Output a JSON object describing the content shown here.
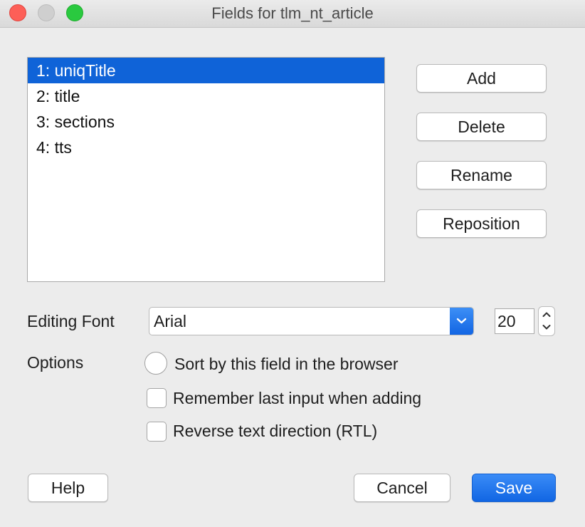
{
  "window": {
    "title": "Fields for tlm_nt_article"
  },
  "fields": {
    "items": [
      {
        "label": "1: uniqTitle"
      },
      {
        "label": "2: title"
      },
      {
        "label": "3: sections"
      },
      {
        "label": "4: tts"
      }
    ],
    "selected_index": 0
  },
  "actions": {
    "add": "Add",
    "delete": "Delete",
    "rename": "Rename",
    "reposition": "Reposition"
  },
  "editing_font": {
    "label": "Editing Font",
    "font": "Arial",
    "size": "20"
  },
  "options": {
    "label": "Options",
    "sort_by_field": {
      "label": "Sort by this field in the browser",
      "checked": false
    },
    "remember_last_input": {
      "label": "Remember last input when adding",
      "checked": false
    },
    "reverse_text_direction": {
      "label": "Reverse text direction (RTL)",
      "checked": false
    }
  },
  "footer": {
    "help": "Help",
    "cancel": "Cancel",
    "save": "Save"
  },
  "colors": {
    "accent": "#0f63d8",
    "close": "#fd5f57",
    "maximize": "#2ac93f"
  },
  "icons": {
    "dropdown": "chevron-updown-icon",
    "stepper_up": "chevron-up-icon",
    "stepper_down": "chevron-down-icon"
  }
}
